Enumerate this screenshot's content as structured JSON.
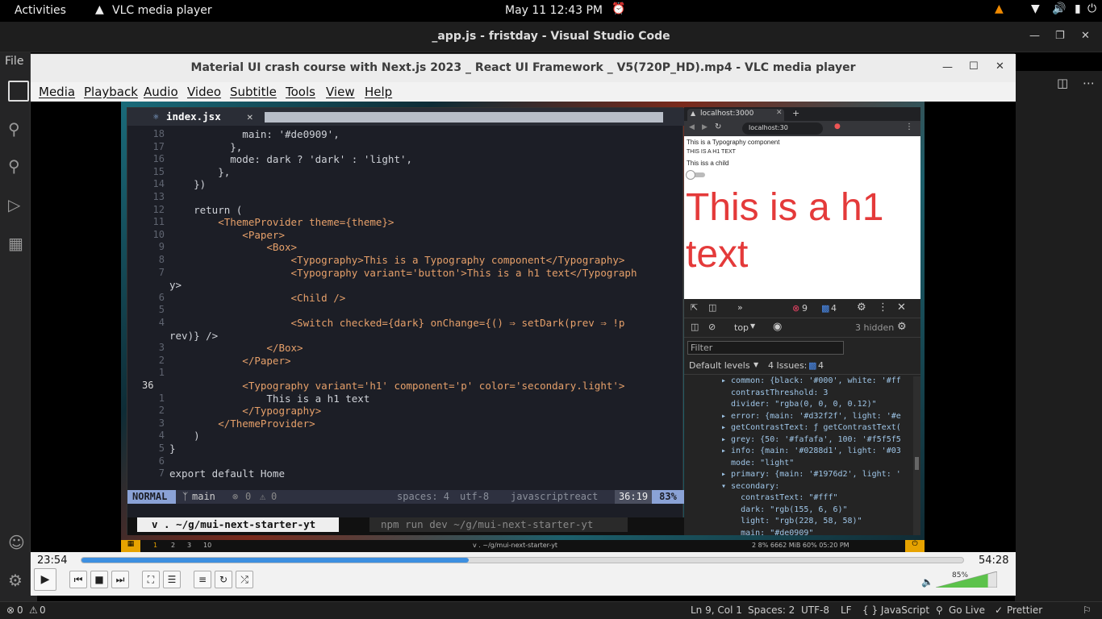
{
  "gnome": {
    "activities": "Activities",
    "app": "VLC media player",
    "clock": "May 11  12:43 PM"
  },
  "vscode": {
    "title": "_app.js - fristday - Visual Studio Code",
    "file_menu": "File",
    "status": {
      "errors": "0",
      "warnings": "0",
      "cursor": "Ln 9, Col 1",
      "spaces": "Spaces: 2",
      "encoding": "UTF-8",
      "eol": "LF",
      "language": "{ } JavaScript",
      "golive": "Go Live",
      "prettier": "Prettier"
    }
  },
  "vlc": {
    "title": "Material UI crash course with Next.js 2023 _ React UI Framework _ V5(720P_HD).mp4 - VLC media player",
    "menu": [
      "Media",
      "Playback",
      "Audio",
      "Video",
      "Subtitle",
      "Tools",
      "View",
      "Help"
    ],
    "elapsed": "23:54",
    "total": "54:28",
    "progress": 0.439,
    "volume_label": "85%",
    "volume": 0.85
  },
  "editor": {
    "tab": "index.jsx",
    "lines": [
      {
        "n": "18",
        "t": "            main: '#de0909',"
      },
      {
        "n": "17",
        "t": "          },"
      },
      {
        "n": "16",
        "t": "          mode: dark ? 'dark' : 'light',"
      },
      {
        "n": "15",
        "t": "        },"
      },
      {
        "n": "14",
        "t": "    })"
      },
      {
        "n": "13",
        "t": ""
      },
      {
        "n": "12",
        "t": "    return ("
      },
      {
        "n": "11",
        "t": "        <ThemeProvider theme={theme}>"
      },
      {
        "n": "10",
        "t": "            <Paper>"
      },
      {
        "n": "9",
        "t": "                <Box>"
      },
      {
        "n": "8",
        "t": "                    <Typography>This is a Typography component</Typography>"
      },
      {
        "n": "7",
        "t": "                    <Typography variant='button'>This is a h1 text</Typograph"
      },
      {
        "n": "",
        "t": "y>"
      },
      {
        "n": "6",
        "t": "                    <Child />"
      },
      {
        "n": "5",
        "t": ""
      },
      {
        "n": "4",
        "t": "                    <Switch checked={dark} onChange={() ⇒ setDark(prev ⇒ !p"
      },
      {
        "n": "",
        "t": "rev)} />"
      },
      {
        "n": "3",
        "t": "                </Box>"
      },
      {
        "n": "2",
        "t": "            </Paper>"
      },
      {
        "n": "1",
        "t": ""
      },
      {
        "n": "36",
        "t": "            <Typography variant='h1' component='p' color='secondary.light'>"
      },
      {
        "n": "1",
        "t": "                This is a h1 text"
      },
      {
        "n": "2",
        "t": "            </Typography>"
      },
      {
        "n": "3",
        "t": "        </ThemeProvider>"
      },
      {
        "n": "4",
        "t": "    )"
      },
      {
        "n": "5",
        "t": "}"
      },
      {
        "n": "6",
        "t": ""
      },
      {
        "n": "7",
        "t": "export default Home"
      }
    ],
    "mode": "NORMAL",
    "branch": "main",
    "diag_err": "0",
    "diag_warn": "0",
    "spaces": "spaces: 4",
    "enc": "utf-8",
    "filetype": "javascriptreact",
    "pos": "36:19",
    "pct": "83%",
    "tmux_left": "v . ~/g/mui-next-starter-yt",
    "tmux_right": "npm run dev ~/g/mui-next-starter-yt"
  },
  "browser": {
    "tab": "localhost:3000",
    "url": "localhost:30",
    "page": {
      "line1": "This is a Typography component",
      "line2": "THIS IS A H1 TEXT",
      "line3": "This iss a child",
      "h1": "This is a h1 text"
    },
    "devtools": {
      "errors": "9",
      "issues_badge": "4",
      "context": "top",
      "hidden": "3 hidden",
      "filter_placeholder": "Filter",
      "levels": "Default levels",
      "issues": "4 Issues:",
      "issues_count": "4",
      "tree": [
        {
          "t": "▸ common: {black: '#000', white: '#ff"
        },
        {
          "t": "  contrastThreshold: 3"
        },
        {
          "t": "  divider: \"rgba(0, 0, 0, 0.12)\""
        },
        {
          "t": "▸ error: {main: '#d32f2f', light: '#e"
        },
        {
          "t": "▸ getContrastText: ƒ getContrastText("
        },
        {
          "t": "▸ grey: {50: '#fafafa', 100: '#f5f5f5"
        },
        {
          "t": "▸ info: {main: '#0288d1', light: '#03"
        },
        {
          "t": "  mode: \"light\""
        },
        {
          "t": "▸ primary: {main: '#1976d2', light: '"
        },
        {
          "t": "▾ secondary:"
        },
        {
          "t": "    contrastText: \"#fff\""
        },
        {
          "t": "    dark: \"rgb(155, 6, 6)\""
        },
        {
          "t": "    light: \"rgb(228, 58, 58)\""
        },
        {
          "t": "    main: \"#de0909\""
        }
      ]
    }
  },
  "dock": {
    "workspaces": [
      "1",
      "2",
      "3",
      "10"
    ],
    "center": "v . ~/g/mui-next-starter-yt",
    "right": "2  8%  6662 MiB  60%  05:20 PM"
  },
  "colors": {
    "accent_blue": "#3d8fe0",
    "vim_mode_bg": "#8aa2d6",
    "h1_red": "#e43a3a"
  }
}
